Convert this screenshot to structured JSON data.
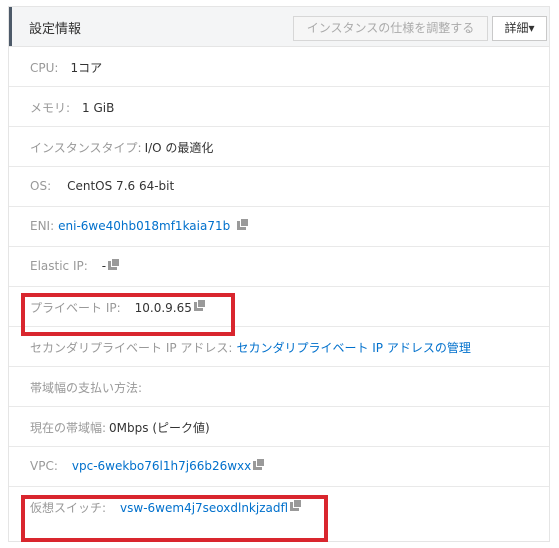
{
  "header": {
    "title": "設定情報",
    "adjust_button": "インスタンスの仕様を調整する",
    "detail_button": "詳細",
    "detail_caret": "▾"
  },
  "rows": {
    "cpu": {
      "label": "CPU:",
      "value": "1コア"
    },
    "memory": {
      "label": "メモリ:",
      "value": "1 GiB"
    },
    "instance_type": {
      "label": "インスタンスタイプ:",
      "value": "I/O の最適化"
    },
    "os": {
      "label": "OS:",
      "value": "CentOS 7.6 64-bit"
    },
    "eni": {
      "label": "ENI:",
      "value": "eni-6we40hb018mf1kaia71b"
    },
    "elastic_ip": {
      "label": "Elastic IP:",
      "value": "-"
    },
    "private_ip": {
      "label": "プライベート IP:",
      "value": "10.0.9.65"
    },
    "secondary_ip": {
      "label": "セカンダリプライベート IP アドレス:",
      "link": "セカンダリプライベート IP アドレスの管理"
    },
    "billing": {
      "label": "帯域幅の支払い方法:"
    },
    "bandwidth": {
      "label": "現在の帯域幅:",
      "value": "0Mbps (ピーク値)"
    },
    "vpc": {
      "label": "VPC:",
      "value": "vpc-6wekbo76l1h7j66b26wxx"
    },
    "vswitch": {
      "label": "仮想スイッチ:",
      "value": "vsw-6wem4j7seoxdlnkjzadfl"
    }
  },
  "highlight_color": "#d9262e",
  "link_color": "#0070cc"
}
